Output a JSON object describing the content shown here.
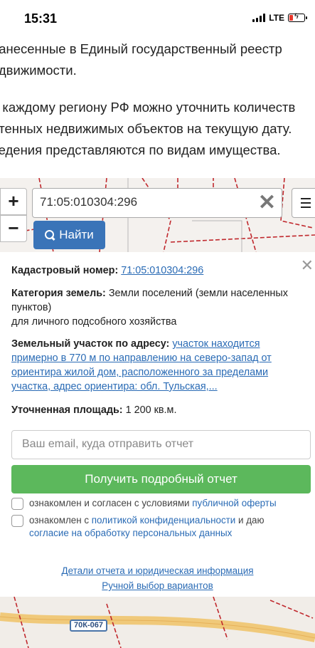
{
  "status_bar": {
    "time": "15:31",
    "network": "LTE"
  },
  "article": {
    "para1_lines": [
      "нанесенные в Единый государственный реестр",
      "едвижимости."
    ],
    "para2_lines": [
      "о каждому региону РФ можно уточнить количеств",
      "нтенных недвижимых объектов на текущую дату.",
      "ведения представляются по видам имущества."
    ]
  },
  "map": {
    "zoom_in": "+",
    "zoom_out": "−",
    "search_value": "71:05:010304:296",
    "find_label": "Найти",
    "road_badge": "70К-067"
  },
  "panel": {
    "cadastral_label": "Кадастровый номер:",
    "cadastral_value": "71:05:010304:296",
    "category_label": "Категория земель:",
    "category_value": "Земли поселений (земли населенных пунктов)",
    "category_use": "для личного подсобного хозяйства",
    "address_label": "Земельный участок по адресу:",
    "address_value": "участок находится примерно в 770 м по направлению на северо-запад от ориентира жилой дом, расположенного за пределами участка, адрес ориентира: обл. Тульская,...",
    "area_label": "Уточненная площадь:",
    "area_value": "1 200 кв.м.",
    "email_placeholder": "Ваш email, куда отправить отчет",
    "report_button": "Получить подробный отчет",
    "consent1_text": "ознакомлен и согласен с условиями",
    "consent1_link": "публичной оферты",
    "consent2_text": "ознакомлен с",
    "consent2_link1": "политикой конфиденциальности",
    "consent2_mid": "и даю",
    "consent2_link2": "согласие на обработку персональных данных",
    "footer_link1": "Детали отчета и юридическая информация",
    "footer_link2": "Ручной выбор вариантов"
  },
  "colors": {
    "find_button": "#3a74b8",
    "report_button": "#5cb85c",
    "link": "#2a6bb5",
    "parcel_lines": "#c0282d"
  }
}
